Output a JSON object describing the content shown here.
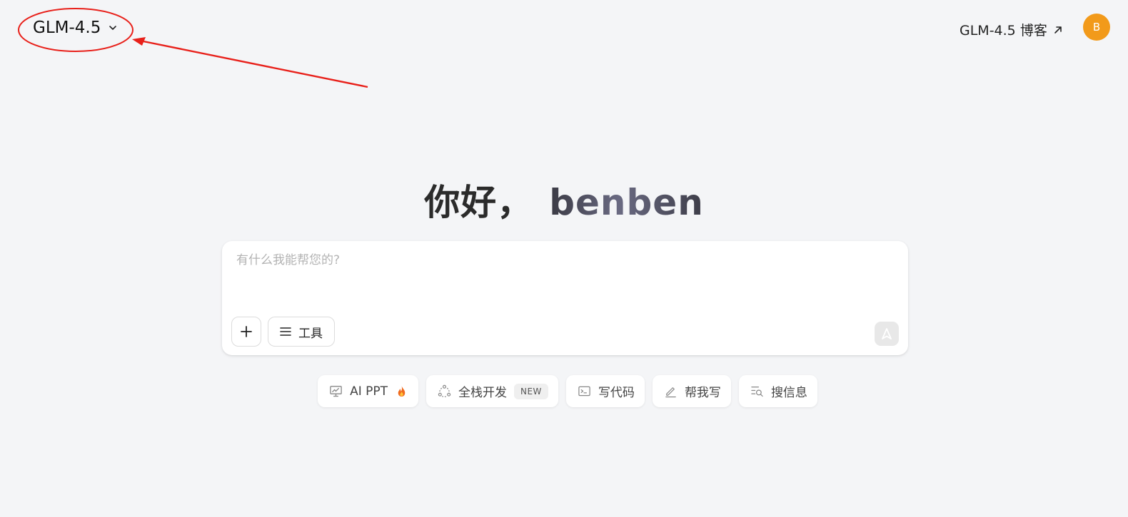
{
  "header": {
    "model_name": "GLM-4.5",
    "blog_link": "GLM-4.5 博客",
    "avatar_initial": "B"
  },
  "greeting": {
    "hello": "你好，",
    "username": "benben"
  },
  "composer": {
    "placeholder": "有什么我能帮您的?",
    "value": "",
    "tools_label": "工具"
  },
  "suggestions": [
    {
      "label": "AI PPT",
      "icon": "presentation-icon",
      "extra_icon": "fire-icon"
    },
    {
      "label": "全栈开发",
      "icon": "fullstack-icon",
      "badge": "NEW"
    },
    {
      "label": "写代码",
      "icon": "terminal-icon"
    },
    {
      "label": "帮我写",
      "icon": "pen-icon"
    },
    {
      "label": "搜信息",
      "icon": "search-list-icon"
    }
  ],
  "colors": {
    "background": "#f4f5f7",
    "avatar": "#f29a1a",
    "annotation": "#e8201a"
  }
}
